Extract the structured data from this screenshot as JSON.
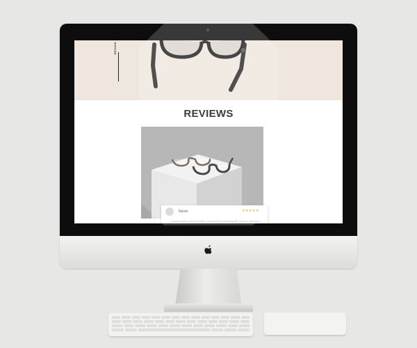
{
  "screen": {
    "hero": {
      "side_label": "DESIGN"
    },
    "reviews": {
      "title": "REVIEWS",
      "card": {
        "reviewer_name": "Name",
        "rating": 5,
        "rating_stars": "★★★★★",
        "review_text": "Lorem ipsum dolor sit amet, consectetur adipiscing elit, sed do eiusmod"
      }
    }
  },
  "colors": {
    "hero_background": "#efe7de",
    "star_color": "#f0a020",
    "title_color": "#111111"
  }
}
